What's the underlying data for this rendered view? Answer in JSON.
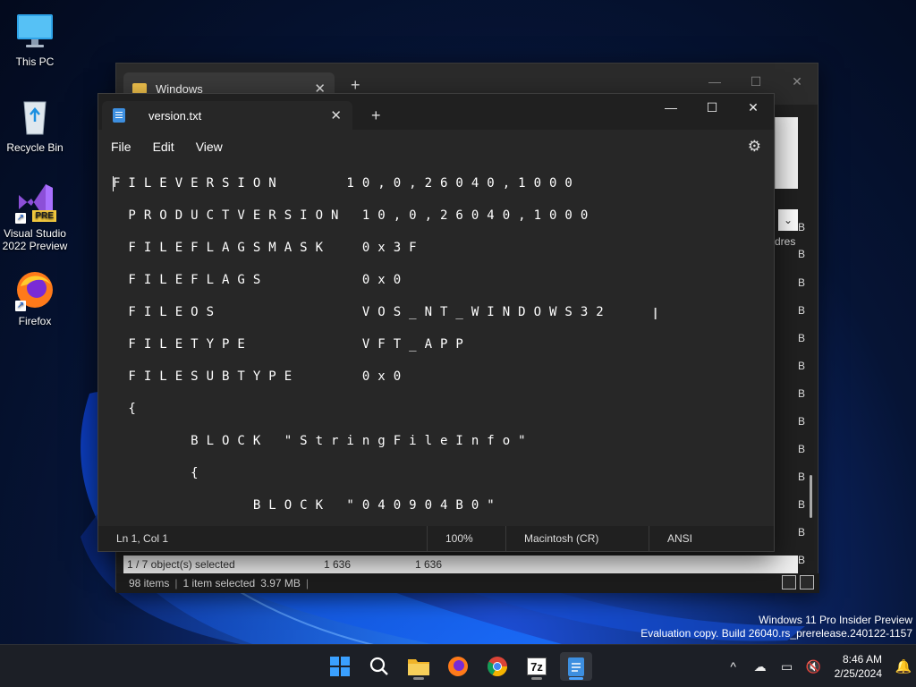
{
  "desktop": {
    "icons": [
      {
        "label": "This PC",
        "icon": "monitor-icon"
      },
      {
        "label": "Recycle Bin",
        "icon": "recycle-bin-icon"
      },
      {
        "label": "Visual Studio 2022 Preview",
        "icon": "visual-studio-icon",
        "badge": "PRE"
      },
      {
        "label": "Firefox",
        "icon": "firefox-icon"
      }
    ]
  },
  "explorer": {
    "tab_title": "Windows",
    "column_letter": "B",
    "partial_header": "dres",
    "status_line1": {
      "selection": "1 / 7 object(s) selected",
      "size1": "1 636",
      "size2": "1 636"
    },
    "status_line2": {
      "items": "98 items",
      "selected": "1 item selected",
      "size": "3.97 MB"
    }
  },
  "notepad": {
    "tab_title": "version.txt",
    "menu": {
      "file": "File",
      "edit": "Edit",
      "view": "View"
    },
    "lines": [
      "FILEVERSION    10,0,26040,1000",
      " PRODUCTVERSION 10,0,26040,1000",
      " FILEFLAGSMASK  0x3F",
      " FILEFLAGS      0x0",
      " FILEOS         VOS_NT_WINDOWS32",
      " FILETYPE       VFT_APP",
      " FILESUBTYPE    0x0",
      " {",
      "     BLOCK \"StringFileInfo\"",
      "     {",
      "         BLOCK \"040904B0\""
    ],
    "status": {
      "position": "Ln 1, Col 1",
      "zoom": "100%",
      "line_ending": "Macintosh (CR)",
      "encoding": "ANSI"
    }
  },
  "watermark": {
    "line1": "Windows 11 Pro Insider Preview",
    "line2": "Evaluation copy. Build 26040.rs_prerelease.240122-1157"
  },
  "taskbar": {
    "time": "8:46 AM",
    "date": "2/25/2024",
    "pinned": [
      "start-icon",
      "search-icon",
      "file-explorer-icon",
      "firefox-icon",
      "chrome-icon",
      "7zip-icon",
      "notepad-icon"
    ],
    "sevenzip_label": "7z"
  },
  "colors": {
    "accent": "#4aa3ff",
    "folder": "#f0c14b"
  }
}
